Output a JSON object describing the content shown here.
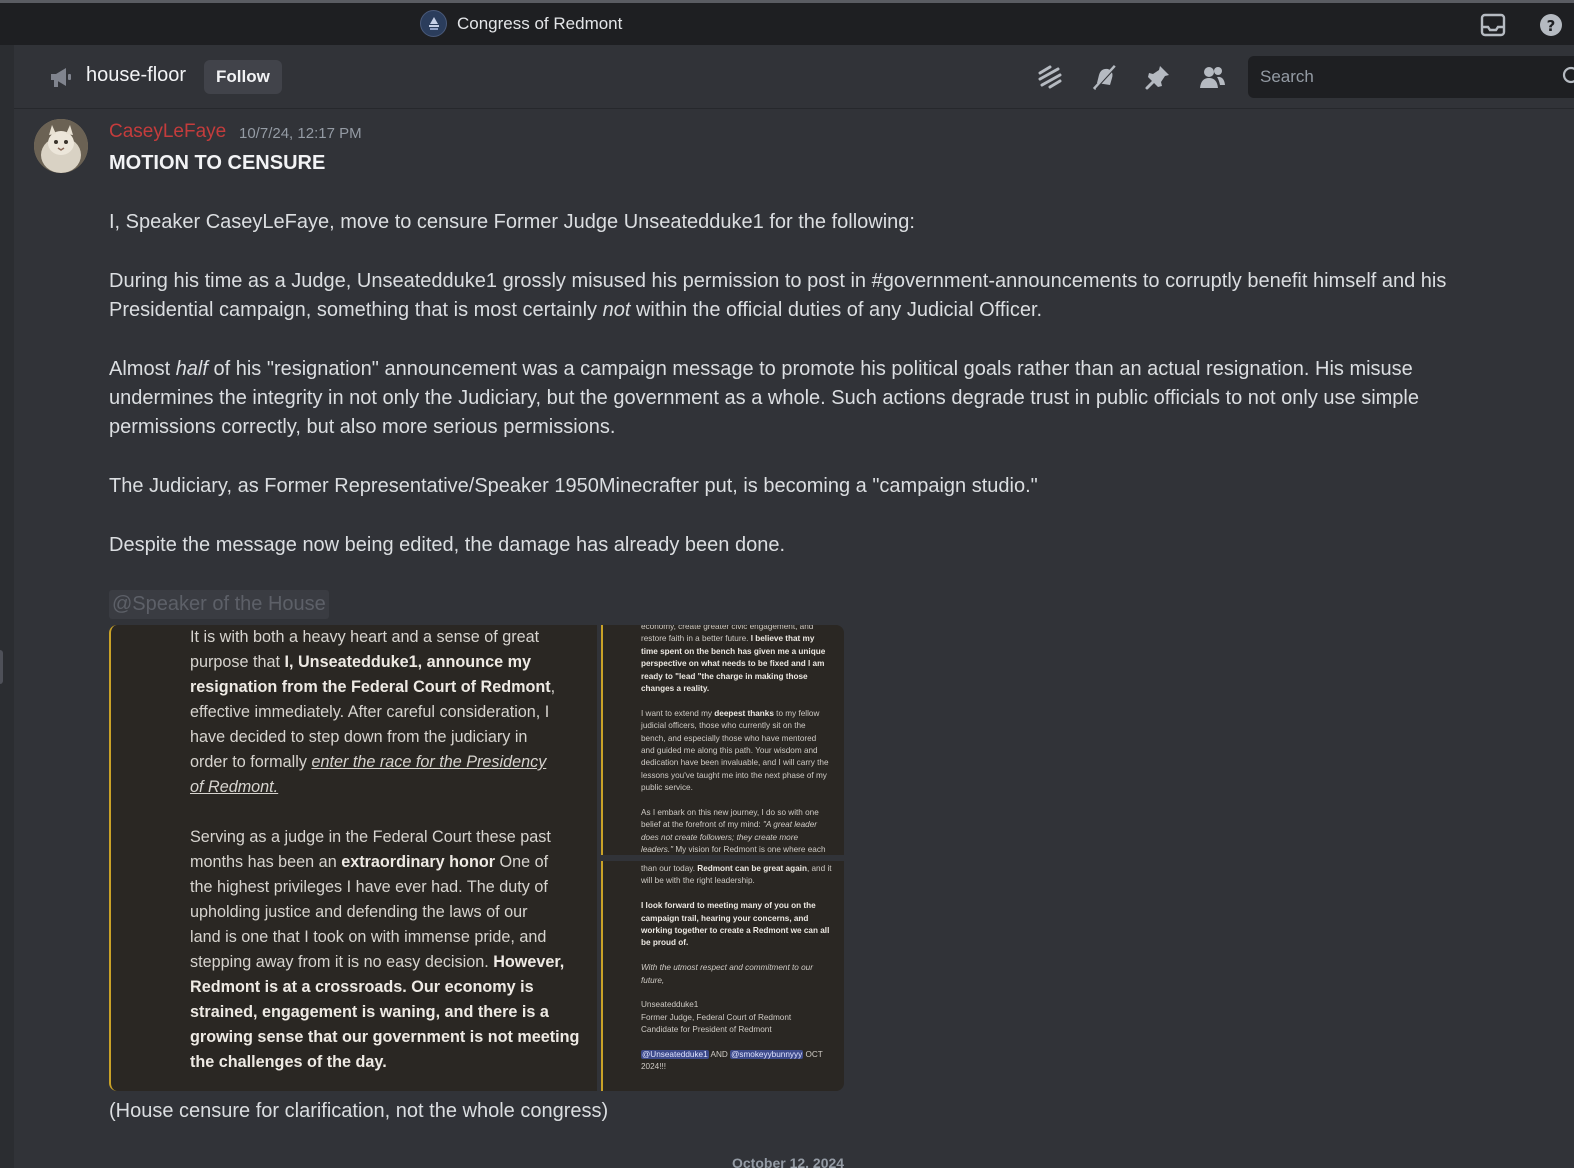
{
  "window": {
    "server_name": "Congress of Redmont"
  },
  "channel": {
    "name": "house-floor",
    "follow_label": "Follow",
    "search_placeholder": "Search"
  },
  "message": {
    "author": "CaseyLeFaye",
    "timestamp": "10/7/24, 12:17 PM",
    "heading": "MOTION TO CENSURE",
    "p1": "I, Speaker CaseyLeFaye, move to censure Former Judge Unseatedduke1 for the following:",
    "p2_a": "During his time as a Judge, Unseatedduke1 grossly misused his permission to post in #government-announcements to corruptly benefit himself and his Presidential campaign, something that is most certainly ",
    "p2_em": "not",
    "p2_b": " within the official duties of any Judicial Officer.",
    "p3_a": "Almost ",
    "p3_em": "half",
    "p3_b": " of his \"resignation\" announcement was a campaign message to promote his political goals rather than an actual resignation. His misuse undermines the integrity in not only the Judiciary, but the government as a whole. Such actions degrade trust in public officials to not only use simple permissions correctly, but also more serious permissions.",
    "p4": "The Judiciary, as Former Representative/Speaker 1950Minecrafter put, is becoming a \"campaign studio.\"",
    "p5": "Despite the message now being edited, the damage has already been done.",
    "mention": "@Speaker of the House",
    "footer_note": "(House censure for clarification, not the whole congress)"
  },
  "attachment_1": {
    "l1": "It is with both a heavy heart and a sense of great",
    "l2a": "purpose that ",
    "l2b": "I, Unseatedduke1, announce my",
    "l3": "resignation from the Federal Court of Redmont",
    "l3c": ",",
    "l4": "effective immediately. After careful consideration, I",
    "l5": "have decided to step down from the judiciary in",
    "l6a": "order to formally ",
    "l6b": "enter the race for the Presidency",
    "l7": "of Redmont.",
    "l8": "Serving as a judge in the Federal Court these past",
    "l9a": "months has been an ",
    "l9b": "extraordinary honor",
    "l9c": " One of",
    "l10": "the highest privileges I have ever had. The duty of",
    "l11": "upholding justice and defending the laws of our",
    "l12": "land is one that I took on with immense pride, and",
    "l13a": "stepping away from it is no easy decision. ",
    "l13b": "However,",
    "l14": "Redmont is at a crossroads. Our economy is",
    "l15": "strained, engagement is waning, and there is a",
    "l16": "growing sense that our government is not meeting",
    "l17": "the challenges of the day."
  },
  "attachment_2": {
    "a1": "economy, create greater civic engagement, and",
    "a2a": "restore faith in a better future. ",
    "a2b": "I believe that my",
    "a3": "time spent on the bench has given me a unique",
    "a4": "perspective on what needs to be fixed and I am",
    "a5": "ready to \"lead \"the charge in making those",
    "a6": "changes a reality.",
    "b1a": "I want to extend my ",
    "b1b": "deepest thanks",
    "b1c": " to my fellow",
    "b2": "judicial officers, those who currently sit on the",
    "b3": "bench, and especially those who have mentored",
    "b4": "and guided me along this path. Your wisdom and",
    "b5": "dedication have been invaluable, and I will carry the",
    "b6": "lessons you've taught me into the next phase of my",
    "b7": "public service.",
    "c1": "As I embark on this new journey, I do so with one",
    "c2a": "belief at the forefront of my mind: ",
    "c2b": "\"A great leader",
    "c3": "does not create followers; they create more",
    "c4a": "leaders.\"",
    "c4b": " My vision for Redmont is one where each"
  },
  "attachment_3": {
    "d1a": "than our today. ",
    "d1b": "Redmont can be great again",
    "d1c": ", and it",
    "d2": "will be with the right leadership.",
    "e1": "I look forward to meeting many of you on the",
    "e2": "campaign trail, hearing your concerns, and",
    "e3": "working together to create a Redmont we can all",
    "e4": "be proud of.",
    "f1": "With the utmost respect and commitment to our",
    "f2": "future,",
    "g1": "Unseatedduke1",
    "g2": "Former Judge, Federal Court of Redmont",
    "g3": "Candidate for President of Redmont",
    "h1": "@Unseatedduke1",
    "h2": " AND ",
    "h3": "@smokeyybunnyyy",
    "h4": " OCT",
    "h5": "2024!!!"
  },
  "divider": {
    "date": "October 12, 2024"
  }
}
